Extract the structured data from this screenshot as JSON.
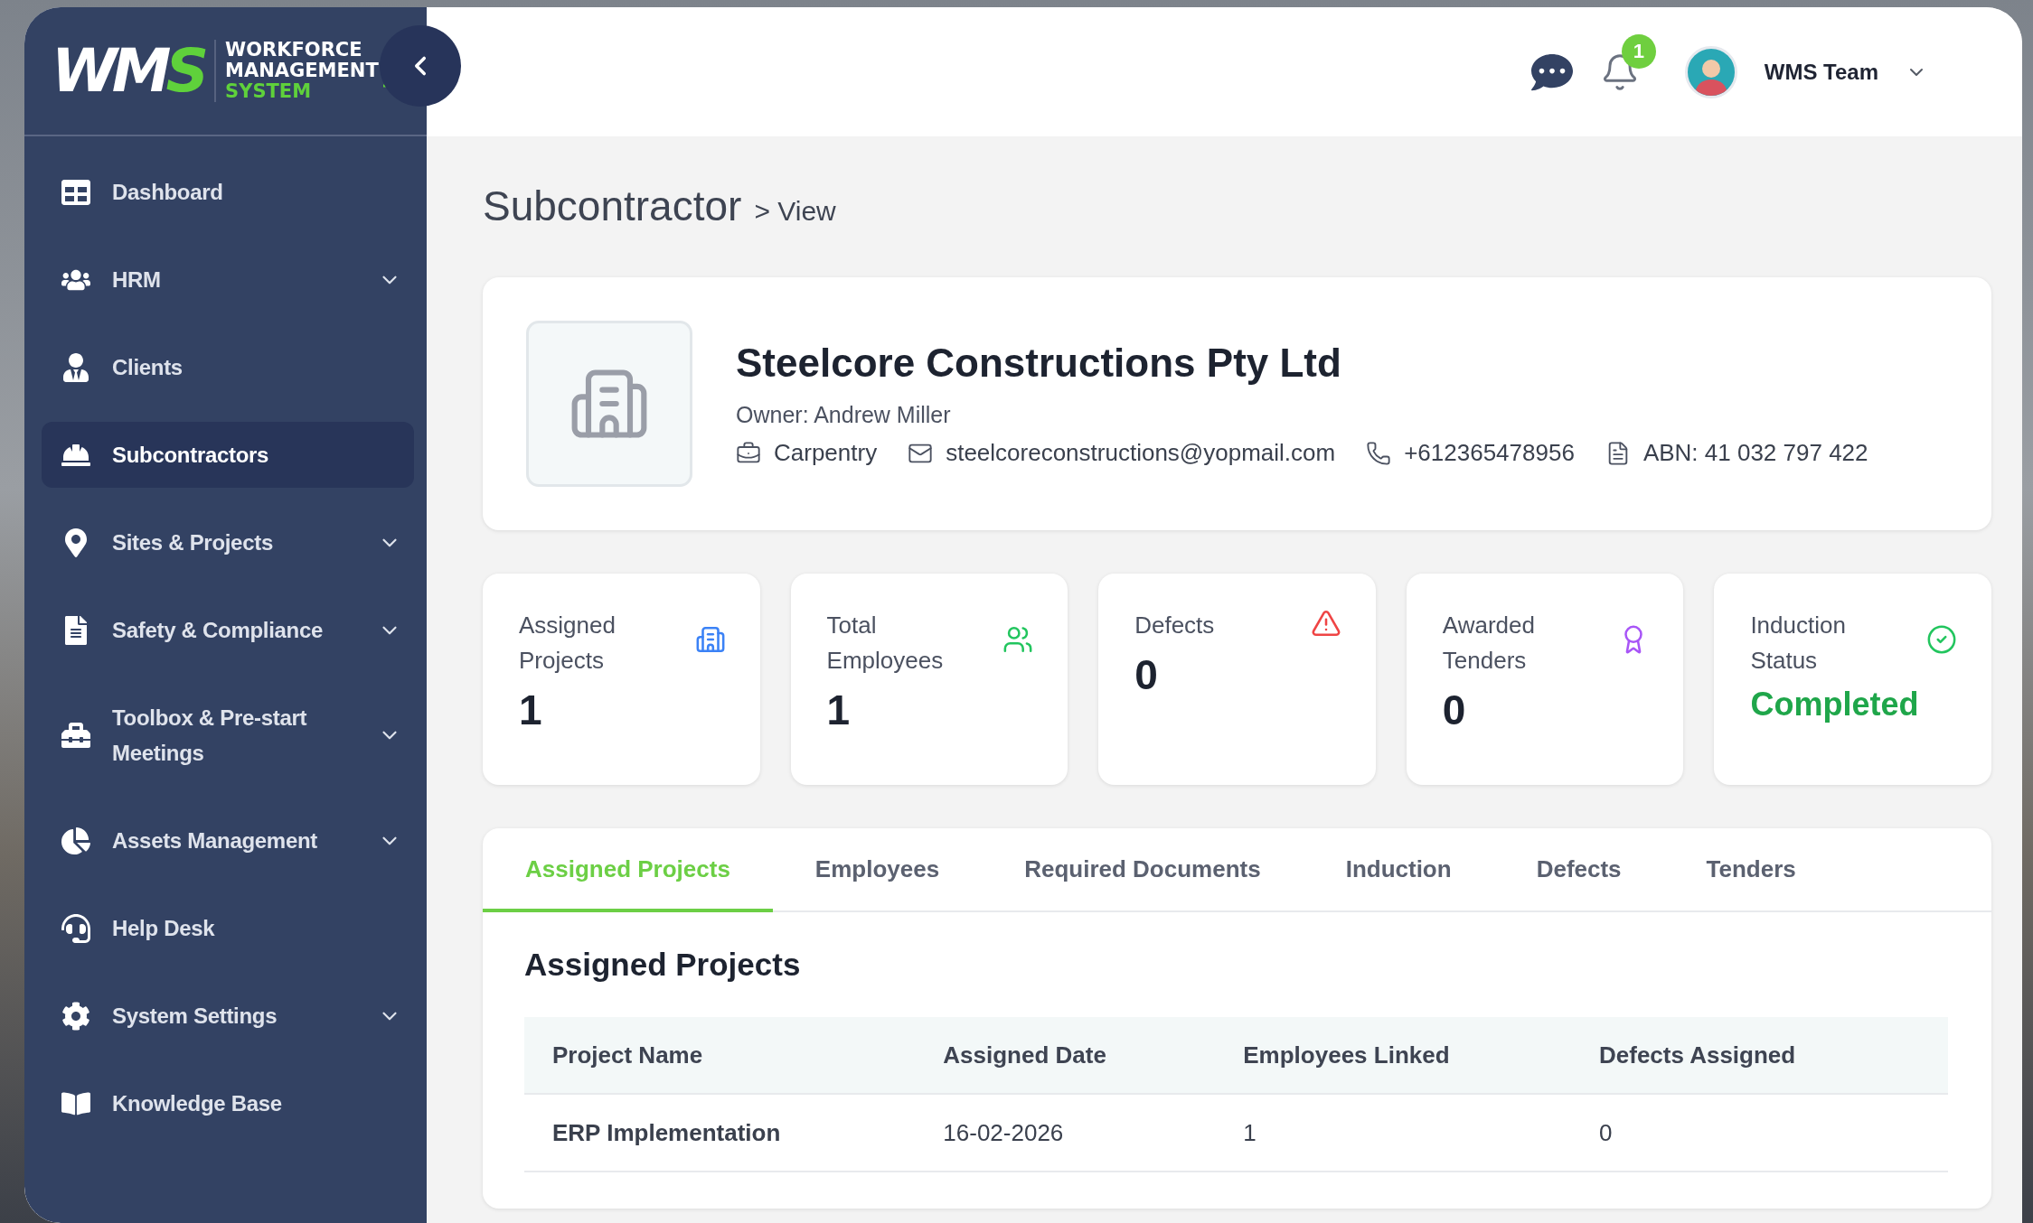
{
  "sidebar": {
    "logo": {
      "mark": "WMS",
      "lines": [
        "WORKFORCE",
        "MANAGEMENT",
        "SYSTEM"
      ]
    },
    "items": [
      {
        "label": "Dashboard",
        "expandable": false,
        "selected": false
      },
      {
        "label": "HRM",
        "expandable": true,
        "selected": false
      },
      {
        "label": "Clients",
        "expandable": false,
        "selected": false
      },
      {
        "label": "Subcontractors",
        "expandable": false,
        "selected": true
      },
      {
        "label": "Sites & Projects",
        "expandable": true,
        "selected": false
      },
      {
        "label": "Safety & Compliance",
        "expandable": true,
        "selected": false
      },
      {
        "label": "Toolbox & Pre-start Meetings",
        "expandable": true,
        "selected": false
      },
      {
        "label": "Assets Management",
        "expandable": true,
        "selected": false
      },
      {
        "label": "Help Desk",
        "expandable": false,
        "selected": false
      },
      {
        "label": "System Settings",
        "expandable": true,
        "selected": false
      },
      {
        "label": "Knowledge Base",
        "expandable": false,
        "selected": false
      }
    ]
  },
  "header": {
    "notification_count": "1",
    "user": "WMS Team"
  },
  "page": {
    "title": "Subcontractor",
    "crumb": "> View"
  },
  "profile": {
    "name": "Steelcore Constructions Pty Ltd",
    "owner": "Owner: Andrew Miller",
    "details": [
      {
        "kind": "trade",
        "text": "Carpentry"
      },
      {
        "kind": "email",
        "text": "steelcoreconstructions@yopmail.com"
      },
      {
        "kind": "phone",
        "text": "+612365478956"
      },
      {
        "kind": "abn",
        "text": "ABN: 41 032 797 422"
      }
    ]
  },
  "stats": [
    {
      "kind": "projects",
      "label": "Assigned Projects",
      "value": "1",
      "color": "#3b82f6"
    },
    {
      "kind": "employees",
      "label": "Total Employees",
      "value": "1",
      "color": "#22c55e"
    },
    {
      "kind": "defects",
      "label": "Defects",
      "value": "0",
      "color": "#ef4444"
    },
    {
      "kind": "tenders",
      "label": "Awarded Tenders",
      "value": "0",
      "color": "#a855f7"
    },
    {
      "kind": "status",
      "label": "Induction Status",
      "value": "Completed",
      "color": "#22c55e"
    }
  ],
  "tabs": [
    {
      "label": "Assigned Projects",
      "selected": true
    },
    {
      "label": "Employees",
      "selected": false
    },
    {
      "label": "Required Documents",
      "selected": false
    },
    {
      "label": "Induction",
      "selected": false
    },
    {
      "label": "Defects",
      "selected": false
    },
    {
      "label": "Tenders",
      "selected": false
    }
  ],
  "section_title": "Assigned Projects",
  "table": {
    "columns": [
      "Project Name",
      "Assigned Date",
      "Employees Linked",
      "Defects Assigned"
    ],
    "rows": [
      [
        "ERP Implementation",
        "16-02-2026",
        "1",
        "0"
      ]
    ]
  }
}
